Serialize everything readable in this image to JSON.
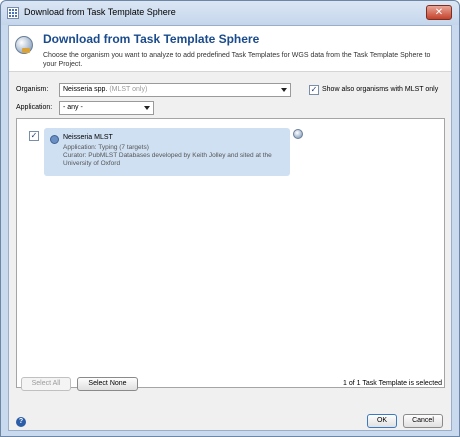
{
  "window": {
    "title": "Download from Task Template Sphere",
    "close_glyph": "✕"
  },
  "header": {
    "title": "Download from Task Template Sphere",
    "description": "Choose the organism you want to analyze to add predefined Task Templates for WGS data from the Task Template Sphere to your Project."
  },
  "organism": {
    "label": "Organism:",
    "value": "Neisseria spp.",
    "hint": "(MLST only)",
    "show_mlst_checked": true,
    "show_mlst_label": "Show also organisms with MLST only"
  },
  "application": {
    "label": "Application:",
    "value": "- any -"
  },
  "templates": [
    {
      "checked": true,
      "name": "Neisseria MLST",
      "application": "Application: Typing (7 targets)",
      "curator": "Curator: PubMLST Databases developed by Keith Jolley and sited at the University of Oxford"
    }
  ],
  "footer": {
    "select_all": "Select All",
    "select_none": "Select None",
    "status": "1 of 1 Task Template is selected",
    "ok": "OK",
    "cancel": "Cancel",
    "help_glyph": "?"
  },
  "colors": {
    "title_blue": "#1a4b8c",
    "card_bg": "#cfe0f2",
    "close_red": "#c4422c"
  }
}
